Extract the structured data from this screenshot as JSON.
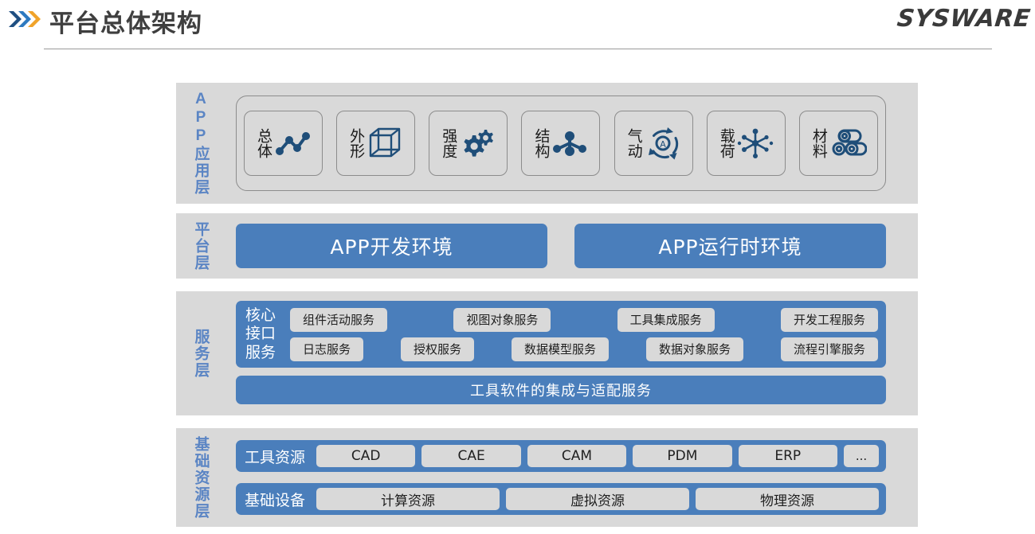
{
  "header": {
    "title": "平台总体架构",
    "brand": "SYSWARE",
    "chevron_colors": [
      "#1f4f82",
      "#2e7ac0",
      "#f0a32a"
    ]
  },
  "colors": {
    "band_background": "#d9d9d9",
    "accent_blue": "#4a7ebb",
    "label_blue": "#5b85c4",
    "icon_navy": "#1f4e79",
    "chip_gray": "#d9d9d9"
  },
  "layers": [
    {
      "id": "app",
      "label": "APP应用层",
      "cards": [
        {
          "label": "总体",
          "icon": "network-nodes-icon"
        },
        {
          "label": "外形",
          "icon": "wireframe-cube-icon"
        },
        {
          "label": "强度",
          "icon": "gears-icon"
        },
        {
          "label": "结构",
          "icon": "molecule-tree-icon"
        },
        {
          "label": "气动",
          "icon": "aero-cycle-icon"
        },
        {
          "label": "载荷",
          "icon": "load-star-icon"
        },
        {
          "label": "材料",
          "icon": "material-rolls-icon"
        }
      ]
    },
    {
      "id": "platform",
      "label": "平台层",
      "boxes": [
        "APP开发环境",
        "APP运行时环境"
      ]
    },
    {
      "id": "service",
      "label": "服务层",
      "core_label": "核心接口服务",
      "core_label_lines": [
        "核心",
        "接口",
        "服务"
      ],
      "chip_rows": [
        [
          "组件活动服务",
          "视图对象服务",
          "工具集成服务",
          "开发工程服务"
        ],
        [
          "日志服务",
          "授权服务",
          "数据模型服务",
          "数据对象服务",
          "流程引擎服务"
        ]
      ],
      "integration_bar": "工具软件的集成与适配服务"
    },
    {
      "id": "infra",
      "label": "基础资源层",
      "rows": [
        {
          "title": "工具资源",
          "items": [
            "CAD",
            "CAE",
            "CAM",
            "PDM",
            "ERP",
            "..."
          ]
        },
        {
          "title": "基础设备",
          "items": [
            "计算资源",
            "虚拟资源",
            "物理资源"
          ]
        }
      ]
    }
  ]
}
